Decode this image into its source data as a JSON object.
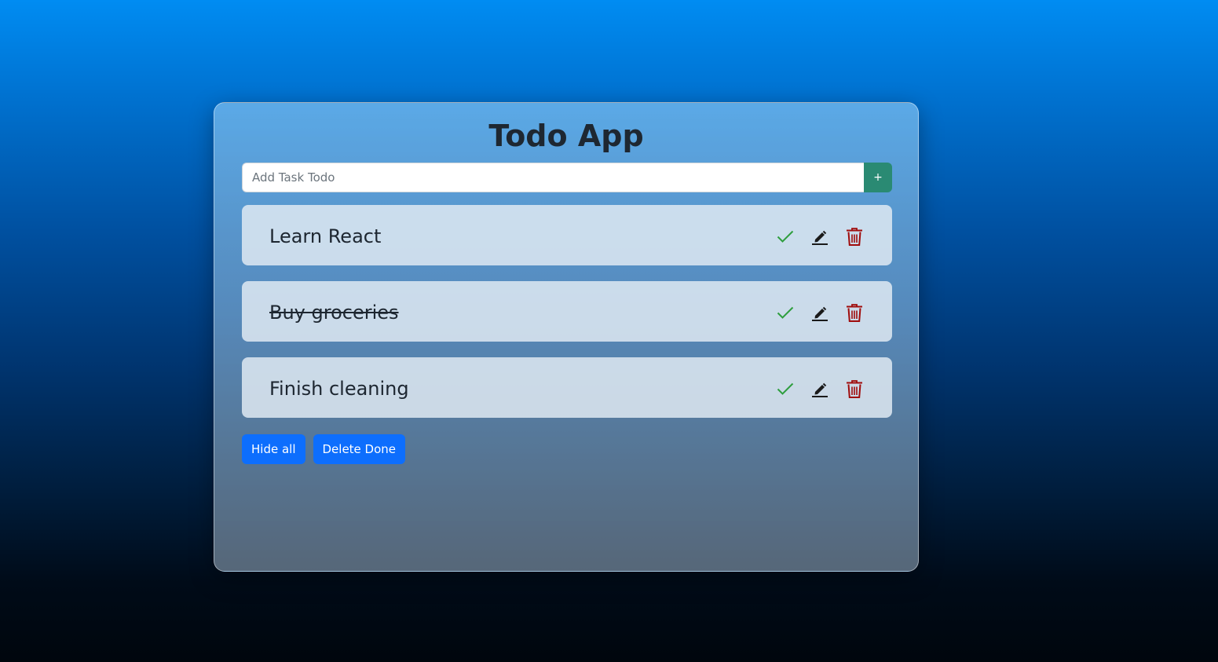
{
  "app": {
    "title": "Todo App"
  },
  "add_task": {
    "placeholder": "Add Task Todo",
    "value": "",
    "button_label": "+"
  },
  "todos": [
    {
      "text": "Learn React",
      "done": false
    },
    {
      "text": "Buy groceries",
      "done": true
    },
    {
      "text": "Finish cleaning",
      "done": false
    }
  ],
  "footer": {
    "hide_all_label": "Hide all",
    "delete_done_label": "Delete Done"
  },
  "icons": {
    "complete": "check-icon",
    "edit": "pencil-icon",
    "delete": "trash-icon"
  },
  "colors": {
    "check": "#2e9e3e",
    "edit": "#1a1a1a",
    "delete": "#a00c0c",
    "add_button": "#2a8a73",
    "primary_button": "#0d6efd"
  }
}
